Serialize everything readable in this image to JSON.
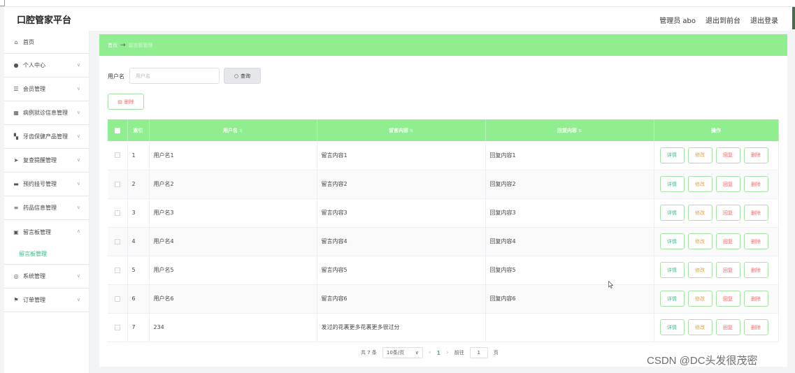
{
  "header": {
    "brand": "口腔管家平台",
    "admin": "管理员 abo",
    "to_front": "退出到前台",
    "logout": "退出登录"
  },
  "sidebar": {
    "items": [
      {
        "label": "首页",
        "icon": "home-icon"
      },
      {
        "label": "个人中心",
        "icon": "user-icon"
      },
      {
        "label": "会员管理",
        "icon": "sliders-icon"
      },
      {
        "label": "病例就诊信息管理",
        "icon": "grid-icon"
      },
      {
        "label": "牙齿保健产品管理",
        "icon": "apps-icon"
      },
      {
        "label": "复查提醒管理",
        "icon": "send-icon"
      },
      {
        "label": "预约挂号管理",
        "icon": "printer-icon"
      },
      {
        "label": "药品信息管理",
        "icon": "list-icon"
      },
      {
        "label": "留言板管理",
        "icon": "trash-icon"
      },
      {
        "label": "系统管理",
        "icon": "compass-icon"
      },
      {
        "label": "订单管理",
        "icon": "flag-icon"
      }
    ],
    "submenu_label": "留言板管理"
  },
  "breadcrumb": {
    "home": "首页",
    "arrow": "→",
    "current": "留言板管理"
  },
  "search": {
    "label": "用户名",
    "placeholder": "用户名",
    "button": "查询"
  },
  "actions": {
    "delete": "删除"
  },
  "table": {
    "headers": [
      "索引",
      "用户名",
      "留言内容",
      "回复内容",
      "操作"
    ],
    "ops": [
      "详情",
      "修改",
      "回复",
      "删除"
    ],
    "rows": [
      {
        "index": "1",
        "username": "用户名1",
        "message": "留言内容1",
        "reply": "回复内容1"
      },
      {
        "index": "2",
        "username": "用户名2",
        "message": "留言内容2",
        "reply": "回复内容2"
      },
      {
        "index": "3",
        "username": "用户名3",
        "message": "留言内容3",
        "reply": "回复内容3"
      },
      {
        "index": "4",
        "username": "用户名4",
        "message": "留言内容4",
        "reply": "回复内容4"
      },
      {
        "index": "5",
        "username": "用户名5",
        "message": "留言内容5",
        "reply": "回复内容5"
      },
      {
        "index": "6",
        "username": "用户名6",
        "message": "留言内容6",
        "reply": "回复内容6"
      },
      {
        "index": "7",
        "username": "234",
        "message": "发过的花裹更多花裹更多很过分",
        "reply": ""
      }
    ]
  },
  "pagination": {
    "total": "共 7 条",
    "page_size": "10条/页",
    "current": "1",
    "goto_label": "前往",
    "goto_value": "1",
    "page_suffix": "页"
  },
  "watermark": "CSDN @DC头发很茂密",
  "colors": {
    "accent": "#90ee90",
    "link_green": "#3dbb85",
    "danger": "#f06b6b",
    "warning": "#e6a23c"
  }
}
